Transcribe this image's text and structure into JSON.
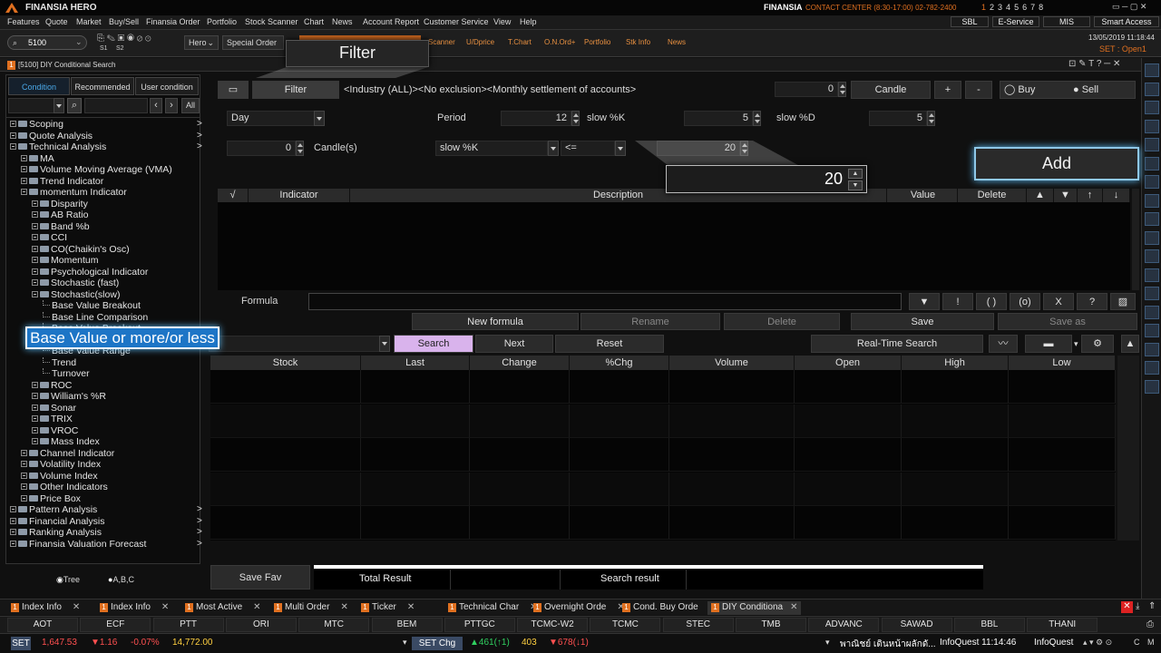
{
  "app": {
    "title": "FINANSIA HERO",
    "brand": "FINANSIA",
    "contact": "CONTACT CENTER (8:30-17:00) 02-782-2400",
    "pages": [
      "1",
      "2",
      "3",
      "4",
      "5",
      "6",
      "7",
      "8"
    ],
    "datetime": "13/05/2019 11:18:44",
    "market_status": "SET : Open1",
    "accent": "#e07020"
  },
  "menu": [
    "Features",
    "Quote",
    "Market",
    "Buy/Sell",
    "Finansia Order",
    "Portfolio",
    "Stock Scanner",
    "Chart",
    "News",
    "Account Report",
    "Customer Service",
    "View",
    "Help"
  ],
  "topright": {
    "sbl": "SBL",
    "eservice": "E-Service",
    "mis": "MIS",
    "smart": "Smart Access"
  },
  "toolbar": {
    "symbol": "5100",
    "hero": "Hero",
    "special_order": "Special Order",
    "shortcuts": [
      "Scanner",
      "U/Dprice",
      "T.Chart",
      "O.N.Ord+",
      "Portfolio",
      "Stk Info",
      "News"
    ],
    "s1": "S1",
    "s2": "S2"
  },
  "window": {
    "title": "[5100] DIY Conditional Search"
  },
  "left": {
    "tabs": [
      "Condition",
      "Recommended",
      "User condition"
    ],
    "all": "All",
    "radio_tree": "Tree",
    "radio_abc": "A,B,C"
  },
  "tree": [
    {
      "label": "Scoping",
      "level": 0,
      "arrow": ">"
    },
    {
      "label": "Quote Analysis",
      "level": 0,
      "arrow": ">"
    },
    {
      "label": "Technical Analysis",
      "level": 0,
      "arrow": ">"
    },
    {
      "label": "MA",
      "level": 1
    },
    {
      "label": "Volume Moving Average (VMA)",
      "level": 1
    },
    {
      "label": "Trend Indicator",
      "level": 1
    },
    {
      "label": "momentum Indicator",
      "level": 1
    },
    {
      "label": "Disparity",
      "level": 2
    },
    {
      "label": "AB Ratio",
      "level": 2
    },
    {
      "label": "Band %b",
      "level": 2
    },
    {
      "label": "CCI",
      "level": 2
    },
    {
      "label": "CO(Chaikin's Osc)",
      "level": 2
    },
    {
      "label": "Momentum",
      "level": 2
    },
    {
      "label": "Psychological Indicator",
      "level": 2
    },
    {
      "label": "Stochastic (fast)",
      "level": 2
    },
    {
      "label": "Stochastic(slow)",
      "level": 2
    },
    {
      "label": "Base Value Breakout",
      "level": 3
    },
    {
      "label": "Base Line Comparison",
      "level": 3
    },
    {
      "label": "Base Value Breakout",
      "level": 3
    },
    {
      "label": "Base Value or more/or less",
      "level": 3
    },
    {
      "label": "Base Value Range",
      "level": 3
    },
    {
      "label": "Trend",
      "level": 3
    },
    {
      "label": "Turnover",
      "level": 3
    },
    {
      "label": "ROC",
      "level": 2
    },
    {
      "label": "William's %R",
      "level": 2
    },
    {
      "label": "Sonar",
      "level": 2
    },
    {
      "label": "TRIX",
      "level": 2
    },
    {
      "label": "VROC",
      "level": 2
    },
    {
      "label": "Mass Index",
      "level": 2
    },
    {
      "label": "Channel Indicator",
      "level": 1
    },
    {
      "label": "Volatility Index",
      "level": 1
    },
    {
      "label": "Volume Index",
      "level": 1
    },
    {
      "label": "Other Indicators",
      "level": 1
    },
    {
      "label": "Price Box",
      "level": 1
    },
    {
      "label": "Pattern Analysis",
      "level": 0,
      "arrow": ">"
    },
    {
      "label": "Financial Analysis",
      "level": 0,
      "arrow": ">"
    },
    {
      "label": "Ranking Analysis",
      "level": 0,
      "arrow": ">"
    },
    {
      "label": "Finansia Valuation Forecast",
      "level": 0,
      "arrow": ">"
    }
  ],
  "filter": {
    "button": "Filter",
    "text": "<Industry (ALL)><No exclusion><Monthly settlement of accounts>",
    "count": "0",
    "candle": "Candle",
    "plus": "+",
    "minus": "-",
    "buy": "Buy",
    "sell": "Sell"
  },
  "params": {
    "period_type": "Day",
    "period_label": "Period",
    "period": "12",
    "slowk_label": "slow %K",
    "slowk": "5",
    "slowd_label": "slow %D",
    "slowd": "5",
    "candle_val": "0",
    "candles_label": "Candle(s)",
    "cond_ind": "slow %K",
    "operator": "<=",
    "value": "20"
  },
  "grid": {
    "headers": [
      "√",
      "Indicator",
      "Description",
      "Value",
      "Delete",
      "▲",
      "▼",
      "↑",
      "↓"
    ]
  },
  "formula": {
    "label": "Formula",
    "ops": [
      "▼",
      "!",
      "( )",
      "(o)",
      "X",
      "?"
    ]
  },
  "actions": {
    "new": "New formula",
    "rename": "Rename",
    "delete": "Delete",
    "save": "Save",
    "save_as": "Save as"
  },
  "search": {
    "search": "Search",
    "next": "Next",
    "reset": "Reset",
    "realtime": "Real-Time Search"
  },
  "results": {
    "headers": [
      "Stock",
      "Last",
      "Change",
      "%Chg",
      "Volume",
      "Open",
      "High",
      "Low"
    ]
  },
  "footer": {
    "save_fav": "Save Fav",
    "total": "Total Result",
    "search_result": "Search result"
  },
  "callouts": {
    "filter": "Filter",
    "add": "Add",
    "value": "20",
    "base_value": "Base Value or more/or less"
  },
  "bottom_tabs": [
    "Index Info",
    "Index Info",
    "Most Active",
    "Multi Order",
    "Ticker",
    "Technical Char",
    "Overnight Orde",
    "Cond. Buy Orde",
    "DIY Conditiona"
  ],
  "ticker": [
    "AOT",
    "ECF",
    "PTT",
    "ORI",
    "MTC",
    "BEM",
    "PTTGC",
    "TCMC-W2",
    "TCMC",
    "STEC",
    "TMB",
    "ADVANC",
    "SAWAD",
    "BBL",
    "THANI"
  ],
  "status": {
    "index": "SET",
    "value": "1,647.53",
    "change": "▼1.16",
    "pct": "-0.07%",
    "volume": "14,772.00",
    "set_chg": "SET Chg",
    "up": "▲461(↑1)",
    "unch": "403",
    "down": "▼678(↓1)",
    "news": "พาณิชย์ เดินหน้าผลักดั...",
    "news_time": "InfoQuest 11:14:46",
    "news_src": "InfoQuest",
    "c": "C",
    "m": "M"
  }
}
